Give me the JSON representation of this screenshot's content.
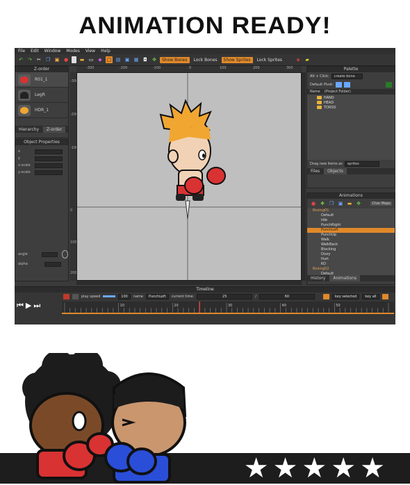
{
  "headline": "ANIMATION READY!",
  "menu": [
    "File",
    "Edit",
    "Window",
    "Modes",
    "View",
    "Help"
  ],
  "toolbar": {
    "show_bones": "Show Bones",
    "lock_bones": "Lock Bones",
    "show_sprites": "Show Sprites",
    "lock_sprites": "Lock Sprites"
  },
  "zorder": {
    "title": "Z-order",
    "items": [
      {
        "label": "R01_1",
        "color": "#d93232"
      },
      {
        "label": "LegR",
        "color": "#333333"
      },
      {
        "label": "HDR_1",
        "color": "#f0a631"
      }
    ],
    "tabs": [
      "Hierarchy",
      "Z-order"
    ]
  },
  "object_properties": {
    "title": "Object Properties",
    "fields": [
      "x",
      "y",
      "x-scale",
      "y-scale"
    ],
    "angle_label": "angle",
    "alpha_label": "alpha"
  },
  "ruler": {
    "top": [
      "-300",
      "-200",
      "-100",
      "0",
      "100",
      "200",
      "300"
    ],
    "left": [
      "-300",
      "-200",
      "-100",
      "0",
      "100",
      "200"
    ]
  },
  "palette": {
    "title": "Palette",
    "alt_click": "Alt + Click:",
    "create_bone": "create bone",
    "default_pivot": "Default Pivot:",
    "col_name": "Name",
    "col_project": "(Project Folder)",
    "folders": [
      "HAND",
      "HEAD",
      "TORSO"
    ],
    "drag_label": "Drag new items as",
    "drag_value": "sprites",
    "tabs": [
      "Files",
      "Objects"
    ]
  },
  "animations": {
    "title": "Animations",
    "char_maps": "Char Maps",
    "rows": [
      {
        "label": "Boxing01",
        "kind": "group"
      },
      {
        "label": "Default",
        "kind": "item"
      },
      {
        "label": "Idle",
        "kind": "item"
      },
      {
        "label": "PunchRight",
        "kind": "item"
      },
      {
        "label": "PunchLeft",
        "kind": "selected"
      },
      {
        "label": "PunchUp",
        "kind": "item"
      },
      {
        "label": "Walk",
        "kind": "item"
      },
      {
        "label": "WalkBack",
        "kind": "item"
      },
      {
        "label": "Blocking",
        "kind": "item"
      },
      {
        "label": "Dizzy",
        "kind": "item"
      },
      {
        "label": "Hurt",
        "kind": "item"
      },
      {
        "label": "KO",
        "kind": "item"
      },
      {
        "label": "Boxing02",
        "kind": "group"
      },
      {
        "label": "Default",
        "kind": "item"
      }
    ],
    "tabs": [
      "History",
      "Animations"
    ]
  },
  "timeline": {
    "title": "Timeline",
    "play_speed_label": "play speed",
    "play_speed": "100",
    "name_label": "name",
    "name_value": "PunchLeft",
    "current_time_label": "current time:",
    "current_time": "25",
    "total_time": "60",
    "key_selected": "key selected",
    "key_all": "key all",
    "ticks": [
      "10",
      "20",
      "30",
      "40",
      "50"
    ],
    "playhead_fraction": 0.4167
  },
  "accent_color": "#e0892a",
  "stars": {
    "count": 5
  }
}
